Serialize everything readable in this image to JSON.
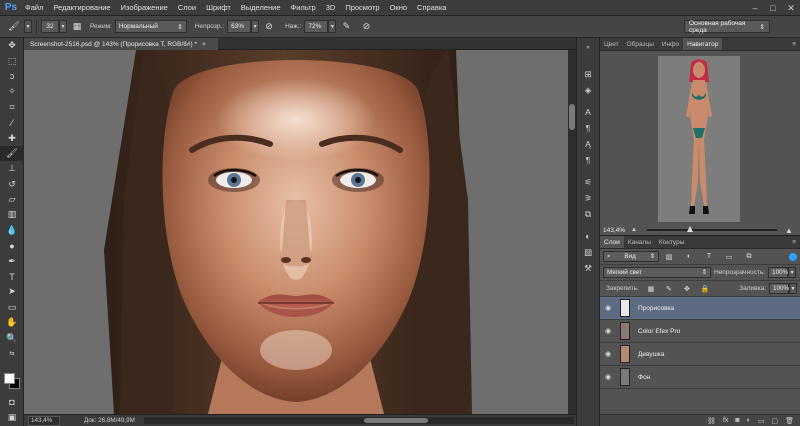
{
  "app": {
    "logo": "Ps"
  },
  "menu": [
    "Файл",
    "Редактирование",
    "Изображение",
    "Слои",
    "Шрифт",
    "Выделение",
    "Фильтр",
    "3D",
    "Просмотр",
    "Окно",
    "Справка"
  ],
  "window_controls": {
    "minimize": "–",
    "maximize": "□",
    "close": "✕"
  },
  "options": {
    "brush_size": "32",
    "mode_label": "Режим:",
    "mode_value": "Нормальный",
    "opacity_label": "Непрозр.:",
    "opacity_value": "63%",
    "flow_label": "Наж.:",
    "flow_value": "72%",
    "workspace": "Основная рабочая среда"
  },
  "document": {
    "tab_title": "Screenshot-2516.psd @ 143% (Прорисовка T, RGB/8#) *",
    "tab_close": "×"
  },
  "status": {
    "zoom": "143,4%",
    "doc_info": "Док: 26,8M/49,9M"
  },
  "navigator": {
    "tabs": [
      "Цвет",
      "Образцы",
      "Инфо",
      "Навигатор"
    ],
    "active_tab": 3,
    "zoom": "143,4%"
  },
  "layers_panel": {
    "tabs": [
      "Слои",
      "Каналы",
      "Контуры"
    ],
    "active_tab": 0,
    "filter_label": "Вид",
    "blend_mode": "Мягкий свет",
    "opacity_label": "Непрозрачность:",
    "opacity_value": "100%",
    "lock_label": "Закрепить:",
    "fill_label": "Заливка:",
    "fill_value": "100%",
    "layers": [
      {
        "name": "Прорисовка",
        "selected": true
      },
      {
        "name": "Color Efex Pro",
        "selected": false
      },
      {
        "name": "Девушка",
        "selected": false
      },
      {
        "name": "Фон",
        "selected": false
      }
    ],
    "footer_icons": [
      "link-icon",
      "fx-icon",
      "mask-icon",
      "adjustment-icon",
      "folder-icon",
      "new-layer-icon",
      "trash-icon"
    ]
  },
  "colors": {
    "ps_blue": "#4ba5ff",
    "selected_layer": "#5c6a82",
    "canvas_bg": "#6e6e6e",
    "foreground": "#ffffff",
    "background": "#000000"
  }
}
